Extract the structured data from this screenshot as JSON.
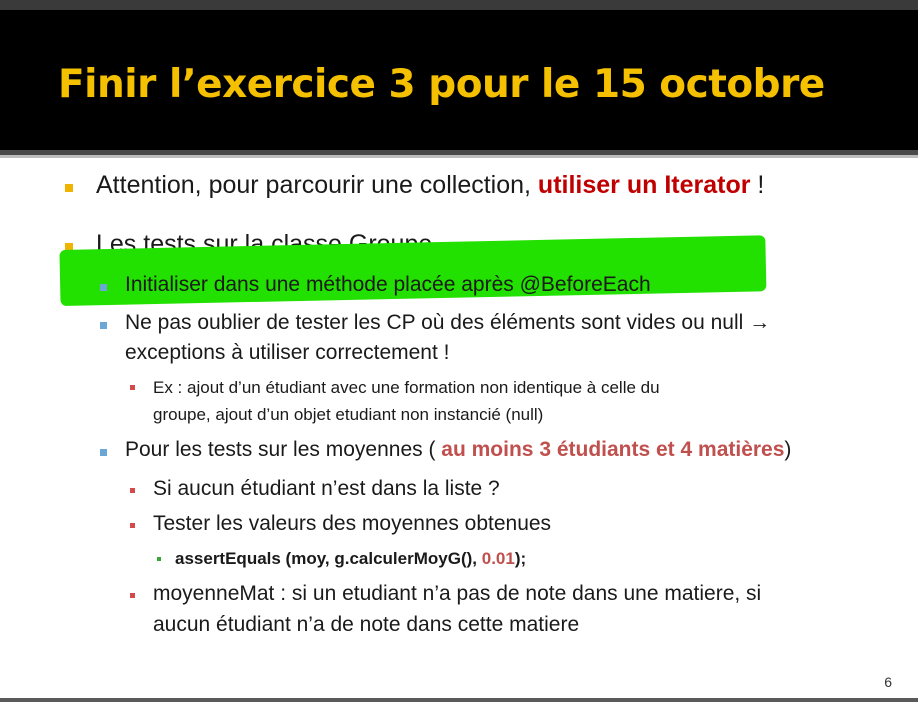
{
  "slide": {
    "title": "Finir l’exercice 3 pour le 15 octobre",
    "page_number": "6"
  },
  "bullets": {
    "b1_text": "Attention, pour parcourir une collection, ",
    "b1_em": "utiliser un Iterator",
    "b1_tail": " !",
    "b2_text": "Les tests sur la classe Groupe",
    "b2_1": "Initialiser dans une méthode placée après @BeforeEach",
    "b2_2_line1": "Ne pas oublier de tester les CP où des éléments sont vides ou null →",
    "b2_2_line2": "exceptions à utiliser correctement !",
    "b2_2_1_line1": "Ex : ajout d’un étudiant avec une formation non identique à celle du",
    "b2_2_1_line2": "groupe, ajout d’un objet etudiant non instancié (null)",
    "b2_3_text": "Pour les tests sur les moyennes ( ",
    "b2_3_em": "au moins 3 étudiants et 4 matières",
    "b2_3_tail": ")",
    "b2_3_1": "Si aucun étudiant n’est dans la liste ?",
    "b2_3_2": "Tester les valeurs des moyennes obtenues",
    "b2_3_2_1_pre": "assertEquals (moy, g.calculerMoyG(), ",
    "b2_3_2_1_num": "0.01",
    "b2_3_2_1_post": ");",
    "b2_3_3_line1": "moyenneMat : si un etudiant n’a pas de note dans une matiere, si",
    "b2_3_3_line2": "aucun étudiant n’a de note dans cette matiere"
  },
  "colors": {
    "title": "#f4c000",
    "header_bg": "#000000",
    "emphasis_red": "#c00000",
    "emphasis_rose": "#c0504d",
    "highlight_green": "#22e000"
  }
}
